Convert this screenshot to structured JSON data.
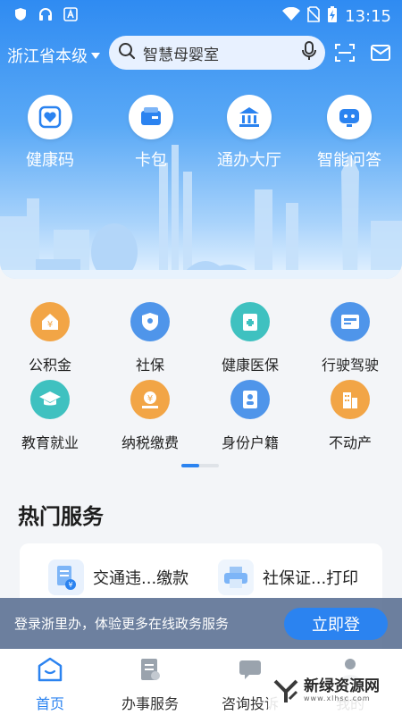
{
  "status_bar": {
    "time": "13:15"
  },
  "header": {
    "region": "浙江省本级",
    "search_placeholder": "智慧母婴室"
  },
  "quick_actions": [
    {
      "label": "健康码",
      "icon": "health-code-icon"
    },
    {
      "label": "卡包",
      "icon": "card-wallet-icon"
    },
    {
      "label": "通办大厅",
      "icon": "service-hall-icon"
    },
    {
      "label": "智能问答",
      "icon": "robot-icon"
    }
  ],
  "services": [
    {
      "label": "公积金",
      "icon": "housing-fund-icon",
      "color": "#f2a546"
    },
    {
      "label": "社保",
      "icon": "social-security-icon",
      "color": "#4f95ea"
    },
    {
      "label": "健康医保",
      "icon": "medical-insurance-icon",
      "color": "#3fc1c0"
    },
    {
      "label": "行驶驾驶",
      "icon": "driving-license-icon",
      "color": "#4f95ea"
    },
    {
      "label": "教育就业",
      "icon": "education-icon",
      "color": "#3fc1c0"
    },
    {
      "label": "纳税缴费",
      "icon": "tax-payment-icon",
      "color": "#f2a546"
    },
    {
      "label": "身份户籍",
      "icon": "id-card-icon",
      "color": "#4f95ea"
    },
    {
      "label": "不动产",
      "icon": "real-estate-icon",
      "color": "#f2a546"
    }
  ],
  "hot_services": {
    "title": "热门服务",
    "items": [
      {
        "label": "交通违...缴款",
        "icon": "traffic-fine-icon"
      },
      {
        "label": "社保证...打印",
        "icon": "printer-icon"
      }
    ]
  },
  "login_prompt": {
    "text": "登录浙里办，体验更多在线政务服务",
    "button": "立即登"
  },
  "bottom_nav": [
    {
      "label": "首页",
      "icon": "home-icon",
      "active": true
    },
    {
      "label": "办事服务",
      "icon": "service-icon",
      "active": false
    },
    {
      "label": "咨询投诉",
      "icon": "consult-icon",
      "active": false
    },
    {
      "label": "我的",
      "icon": "profile-icon",
      "active": false
    }
  ],
  "watermark": {
    "text": "新绿资源网",
    "sub": "www.xlhsc.com"
  },
  "colors": {
    "primary": "#2b83f0",
    "accent_orange": "#f2a546",
    "accent_teal": "#3fc1c0"
  }
}
